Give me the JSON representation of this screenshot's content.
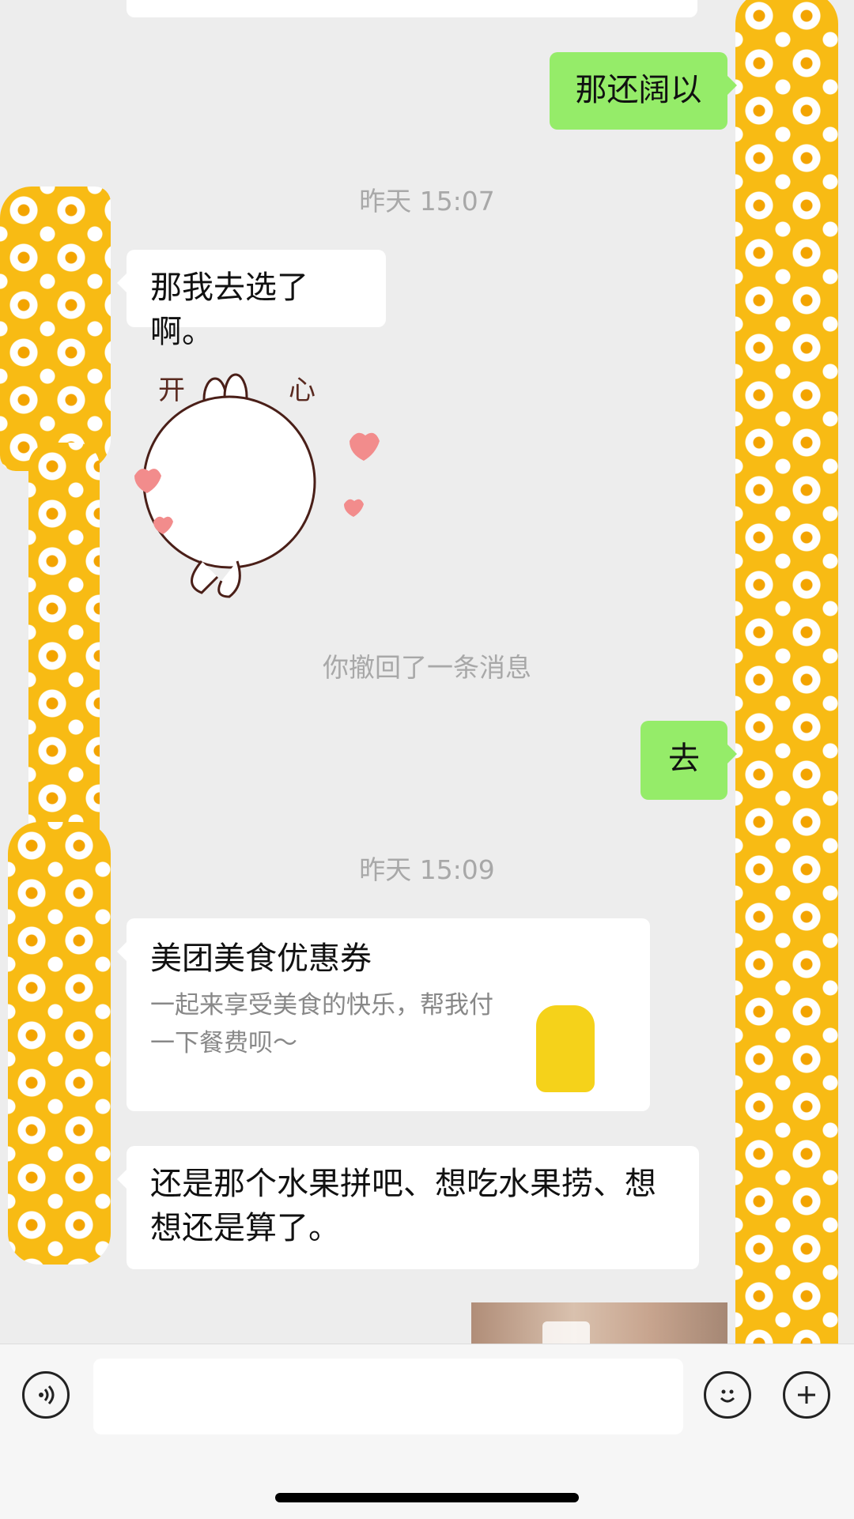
{
  "chat": {
    "msg_green_1": "那还阔以",
    "time_1": "昨天 15:07",
    "msg_white_1": "那我去选了啊。",
    "sticker": {
      "text_left": "开",
      "text_right": "心"
    },
    "recall_notice": "你撤回了一条消息",
    "msg_green_2": "去",
    "time_2": "昨天 15:09",
    "coupon": {
      "title": "美团美食优惠券",
      "desc": "一起来享受美食的快乐，帮我付一下餐费呗～"
    },
    "msg_white_2": "还是那个水果拼吧、想吃水果捞、想想还是算了。"
  },
  "input_bar": {
    "voice_icon": "voice-icon",
    "emoji_icon": "emoji-icon",
    "plus_icon": "plus-icon",
    "input_value": ""
  },
  "colors": {
    "background": "#ededed",
    "bubble_green": "#95ec69",
    "bubble_white": "#ffffff",
    "avatar_yellow": "#f8bb14"
  }
}
